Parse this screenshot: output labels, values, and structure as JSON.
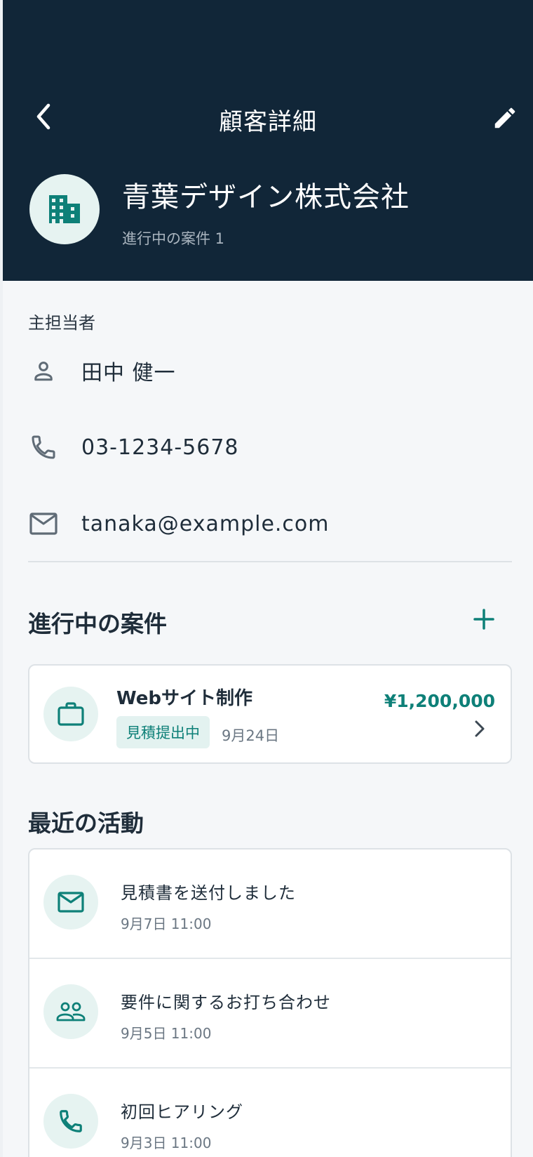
{
  "nav": {
    "title": "顧客詳細"
  },
  "company": {
    "name": "青葉デザイン株式会社",
    "subtitle": "進行中の案件 1",
    "icon": "building-icon"
  },
  "contact": {
    "section_label": "主担当者",
    "person": "田中 健一",
    "phone": "03-1234-5678",
    "email": "tanaka@example.com"
  },
  "cases": {
    "title": "進行中の案件",
    "items": [
      {
        "title": "Webサイト制作",
        "badge": "見積提出中",
        "date": "9月24日",
        "amount": "¥1,200,000",
        "icon": "briefcase-icon"
      }
    ]
  },
  "activities": {
    "title": "最近の活動",
    "items": [
      {
        "title": "見積書を送付しました",
        "time": "9月7日 11:00",
        "icon": "mail-icon"
      },
      {
        "title": "要件に関するお打ち合わせ",
        "time": "9月5日 11:00",
        "icon": "people-icon"
      },
      {
        "title": "初回ヒアリング",
        "time": "9月3日 11:00",
        "icon": "phone-icon"
      }
    ]
  },
  "colors": {
    "header_bg": "#112638",
    "accent": "#0e8078",
    "icon_bg": "#e6f3f1"
  }
}
